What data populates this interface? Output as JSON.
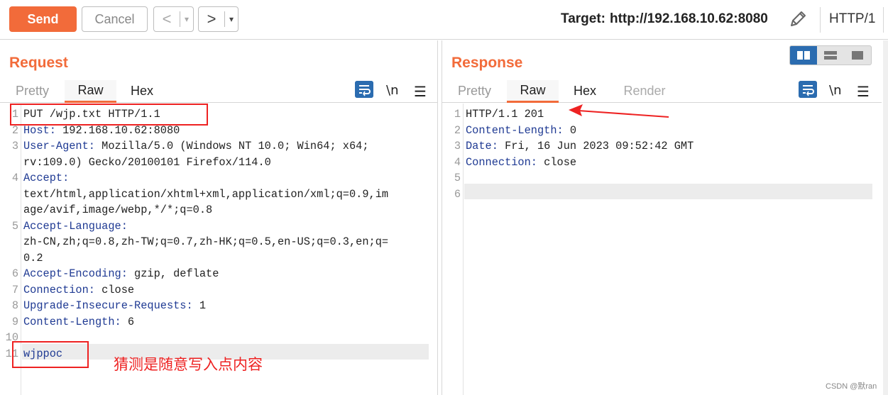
{
  "toolbar": {
    "send_label": "Send",
    "cancel_label": "Cancel",
    "back_glyph": "<",
    "forward_glyph": ">",
    "caret_glyph": "▾",
    "target_label": "Target:",
    "target_url": "http://192.168.10.62:8080",
    "edit_icon": "pencil-icon",
    "http_version": "HTTP/1"
  },
  "request": {
    "title": "Request",
    "tabs": [
      {
        "label": "Pretty",
        "active": false
      },
      {
        "label": "Raw",
        "active": true
      },
      {
        "label": "Hex",
        "active": false
      }
    ],
    "newline_toggle": "\\n",
    "menu_glyph": "☰",
    "lines": [
      {
        "num": "1",
        "header": "",
        "value": "PUT /wjp.txt HTTP/1.1"
      },
      {
        "num": "2",
        "header": "Host:",
        "value": " 192.168.10.62:8080"
      },
      {
        "num": "3",
        "header": "User-Agent:",
        "value": " Mozilla/5.0 (Windows NT 10.0; Win64; x64;"
      },
      {
        "num": "",
        "header": "",
        "value": "rv:109.0) Gecko/20100101 Firefox/114.0"
      },
      {
        "num": "4",
        "header": "Accept:",
        "value": ""
      },
      {
        "num": "",
        "header": "",
        "value": "text/html,application/xhtml+xml,application/xml;q=0.9,im"
      },
      {
        "num": "",
        "header": "",
        "value": "age/avif,image/webp,*/*;q=0.8"
      },
      {
        "num": "5",
        "header": "Accept-Language:",
        "value": ""
      },
      {
        "num": "",
        "header": "",
        "value": "zh-CN,zh;q=0.8,zh-TW;q=0.7,zh-HK;q=0.5,en-US;q=0.3,en;q="
      },
      {
        "num": "",
        "header": "",
        "value": "0.2"
      },
      {
        "num": "6",
        "header": "Accept-Encoding:",
        "value": " gzip, deflate"
      },
      {
        "num": "7",
        "header": "Connection:",
        "value": " close"
      },
      {
        "num": "8",
        "header": "Upgrade-Insecure-Requests:",
        "value": " 1"
      },
      {
        "num": "9",
        "header": "Content-Length:",
        "value": " 6"
      },
      {
        "num": "10",
        "header": "",
        "value": ""
      },
      {
        "num": "11",
        "header": "wjppoc",
        "value": ""
      }
    ]
  },
  "response": {
    "title": "Response",
    "tabs": [
      {
        "label": "Pretty",
        "active": false
      },
      {
        "label": "Raw",
        "active": true
      },
      {
        "label": "Hex",
        "active": false
      },
      {
        "label": "Render",
        "active": false
      }
    ],
    "newline_toggle": "\\n",
    "menu_glyph": "☰",
    "lines": [
      {
        "num": "1",
        "header": "",
        "value": "HTTP/1.1 201"
      },
      {
        "num": "2",
        "header": "Content-Length:",
        "value": " 0"
      },
      {
        "num": "3",
        "header": "Date:",
        "value": " Fri, 16 Jun 2023 09:52:42 GMT"
      },
      {
        "num": "4",
        "header": "Connection:",
        "value": " close"
      },
      {
        "num": "5",
        "header": "",
        "value": ""
      },
      {
        "num": "6",
        "header": "",
        "value": ""
      }
    ]
  },
  "annotations": {
    "note": "猜测是随意写入点内容",
    "watermark": "CSDN @默ran",
    "color": "#ee2222"
  },
  "colors": {
    "accent": "#f26b3a",
    "header_key": "#1f3a93",
    "icon_blue": "#2b6cb0"
  }
}
